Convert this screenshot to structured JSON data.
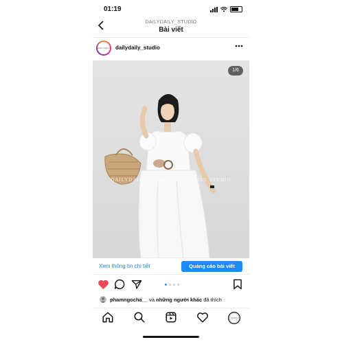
{
  "status_bar": {
    "time": "01:19"
  },
  "header": {
    "account_caption": "DAILYDAILY_STUDIO",
    "title": "Bài viết",
    "back_icon": "chevron-left-icon"
  },
  "post": {
    "username": "dailydaily_studio",
    "avatar_text": "DAILY DAILY",
    "more_icon": "more-horizontal-icon",
    "image_counter": "1/6",
    "watermark": "DAILYDAILY STUDIO   DAILYDAILY STUDIO   DAILYDAILY STUDIO",
    "photo_description_icon": "photo-woman-white-dress",
    "view_insights_label": "Xem thông tin chi tiết",
    "promote_label": "Quảng cáo bài viết",
    "carousel": {
      "total": 4,
      "active": 0
    },
    "liked_by_user": "phamngocha__",
    "liked_by_connector": "và",
    "liked_by_others": "những người khác",
    "liked_by_suffix": "đã thích"
  },
  "actions": [
    "heart-icon",
    "comment-icon",
    "share-icon",
    "bookmark-icon"
  ],
  "bottom_nav": [
    "home-icon",
    "search-icon",
    "reels-icon",
    "activity-heart-icon",
    "profile-icon"
  ],
  "colors": {
    "accent": "#1d8cf8",
    "like_red": "#ed4956",
    "link_blue": "#2a7fd4"
  }
}
